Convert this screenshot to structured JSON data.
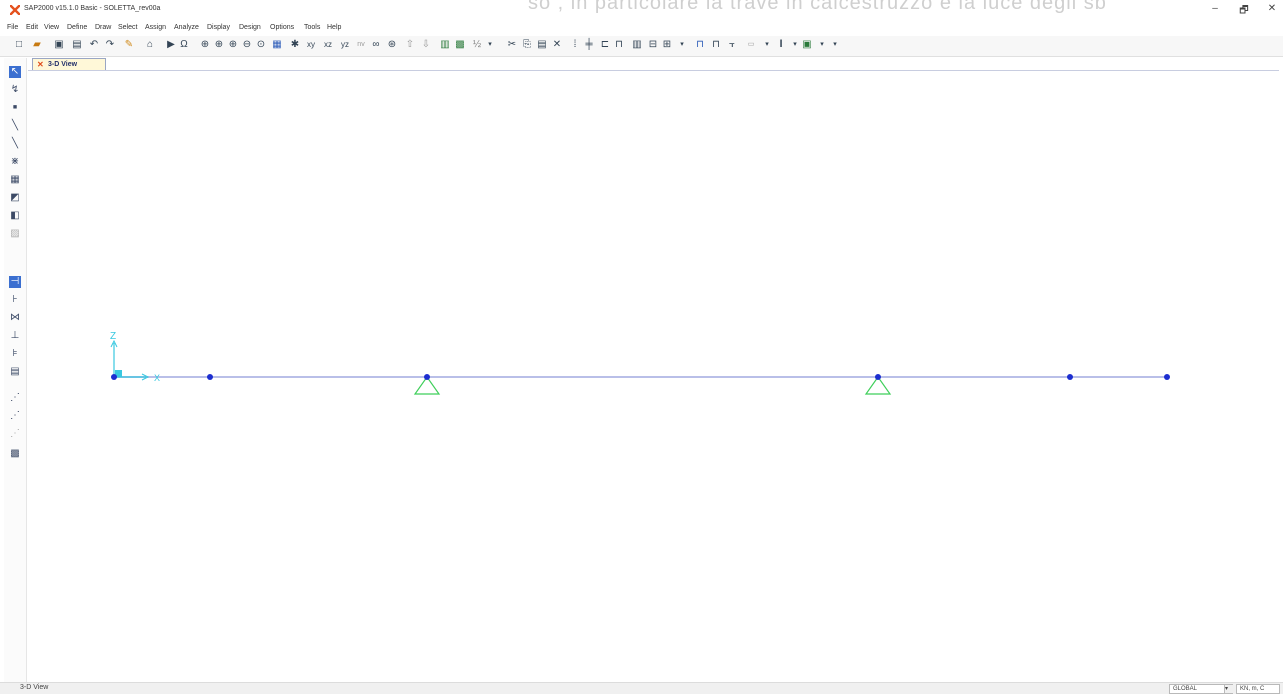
{
  "window": {
    "title": "SAP2000 v15.1.0 Basic  - SOLETTA_rev00a",
    "overlay_text": "so , in particolare la trave in calcestruzzo e la luce degli sb",
    "min_symbol": "–",
    "max_symbol": "🗗",
    "close_symbol": "✕"
  },
  "menu": [
    "File",
    "Edit",
    "View",
    "Define",
    "Draw",
    "Select",
    "Assign",
    "Analyze",
    "Display",
    "Design",
    "Options",
    "Tools",
    "Help"
  ],
  "toolbar": {
    "icons": [
      "new-model-icon",
      "open-icon",
      "save-icon",
      "print-icon",
      "undo-icon",
      "redo-icon",
      "pencil-icon",
      "lock-icon",
      "run-icon",
      "rubber-band-zoom-icon",
      "zoom-restore-icon",
      "zoom-in-icon",
      "zoom-out-icon",
      "pan-icon",
      "default-3d-view-icon",
      "xy-view-icon",
      "xz-view-icon",
      "yz-view-icon",
      "nv-view-icon",
      "rotate-3d-icon",
      "perspective-icon",
      "up-icon",
      "down-icon",
      "object-shrink-icon",
      "set-display-icon",
      "select-icon",
      "reshape-icon",
      "copy-icon",
      "delete-icon",
      "assign-joint-icon",
      "assign-frame-icon",
      "assign-area-icon",
      "load-icon",
      "show-deformed-icon",
      "show-forces-icon",
      "draw-frame-icon",
      "section-icon",
      "graph-icon"
    ],
    "text_items": {
      "xy": "xy",
      "xz": "xz",
      "yz": "yz",
      "nv": "nv"
    }
  },
  "left_toolbar": {
    "icons": [
      "pointer-icon",
      "reshape-icon",
      "draw-joint-icon",
      "draw-frame-icon",
      "draw-line-icon",
      "quick-draw-frame-icon",
      "draw-grid-area-icon",
      "draw-poly-area-icon",
      "draw-rect-area-icon",
      "draw-solid-icon",
      "snap-points-icon",
      "snap-ends-icon",
      "snap-intersections-icon",
      "snap-perpendicular-icon",
      "snap-lines-icon",
      "snap-grid-icon",
      "select-all-icon",
      "get-previous-icon",
      "clear-selection-icon",
      "select-intersect-icon"
    ]
  },
  "tab": {
    "label": "3-D View"
  },
  "viewport": {
    "axis_z_label": "Z",
    "axis_x_label": "X",
    "beam_color": "#b9bfe8",
    "joint_color": "#1c2ed0",
    "support_color": "#3fcf5a",
    "joints": [
      {
        "name": "joint-1",
        "support": false
      },
      {
        "name": "joint-2",
        "support": false
      },
      {
        "name": "joint-3",
        "support": true
      },
      {
        "name": "joint-4",
        "support": true
      },
      {
        "name": "joint-5",
        "support": false
      },
      {
        "name": "joint-6",
        "support": false
      }
    ]
  },
  "status": {
    "left": "3-D View",
    "coord_system": "GLOBAL",
    "units": "KN, m, C",
    "dropdown_arrow": "▾"
  }
}
